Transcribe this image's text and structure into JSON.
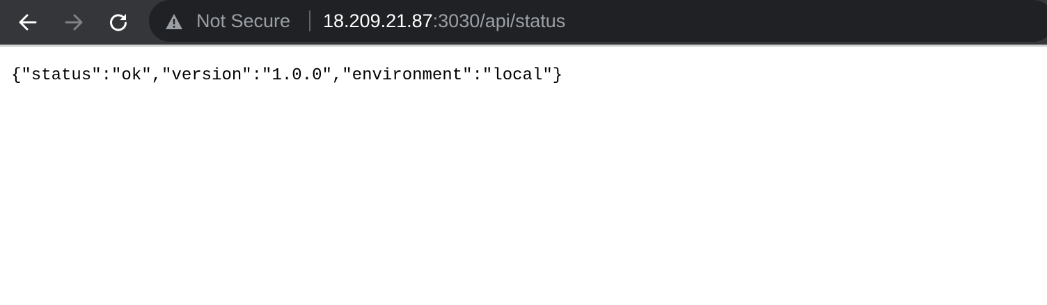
{
  "browser": {
    "nav": {
      "back_icon": "arrow-left-icon",
      "forward_icon": "arrow-right-icon",
      "reload_icon": "reload-icon"
    },
    "omnibox": {
      "security_icon": "warning-triangle-icon",
      "security_label": "Not Secure",
      "url_host": "18.209.21.87",
      "url_rest": ":3030/api/status"
    },
    "colors": {
      "toolbar_bg": "#35363a",
      "omnibox_bg": "#202124",
      "url_dim": "#9aa0a6",
      "url_bright": "#ffffff"
    }
  },
  "page": {
    "body_text": "{\"status\":\"ok\",\"version\":\"1.0.0\",\"environment\":\"local\"}"
  }
}
